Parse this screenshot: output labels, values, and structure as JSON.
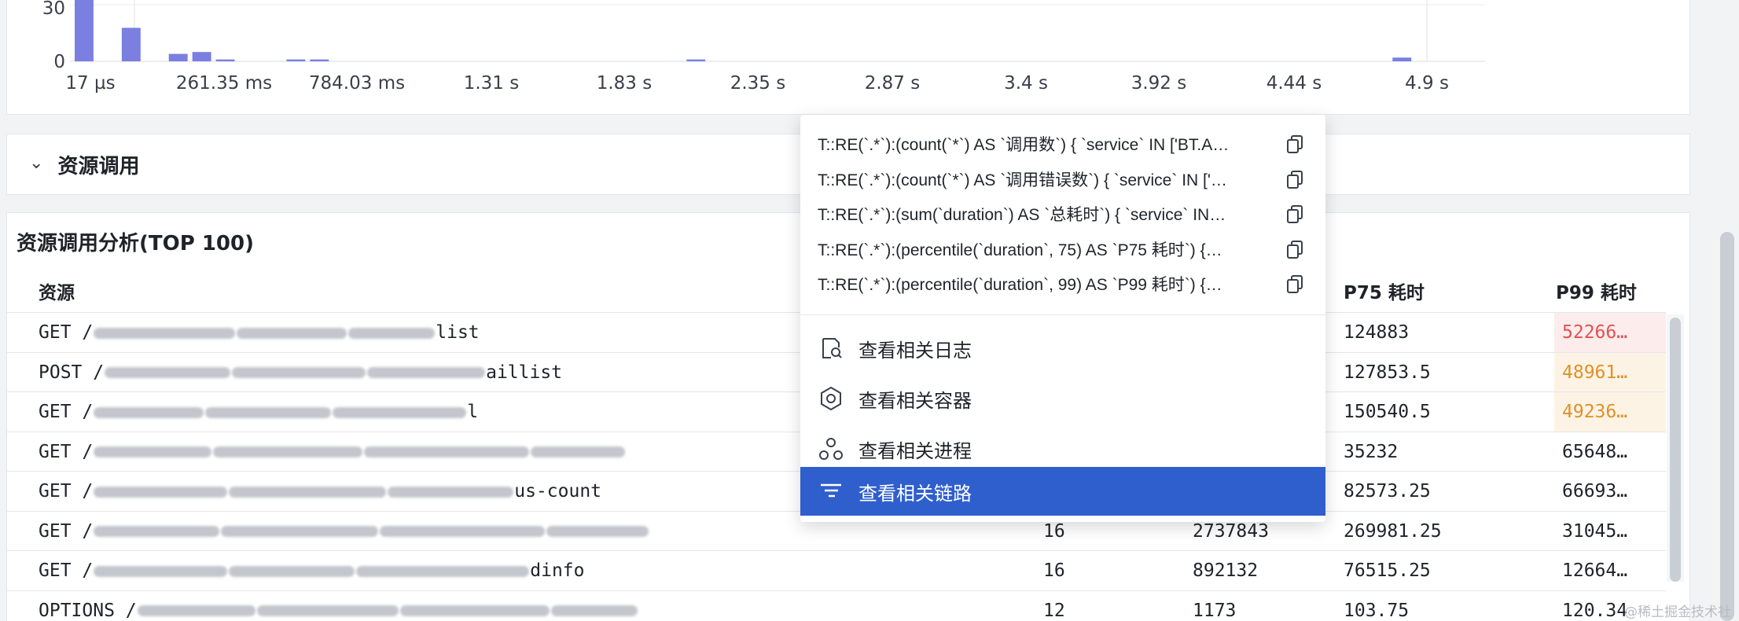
{
  "histogram": {
    "y_ticks": [
      "30",
      "0"
    ],
    "x_ticks": [
      "17 µs",
      "261.35 ms",
      "784.03 ms",
      "1.31 s",
      "1.83 s",
      "2.35 s",
      "2.87 s",
      "3.4 s",
      "3.92 s",
      "4.44 s",
      "4.9 s"
    ],
    "bar_color": "#7b7fe0",
    "bars": [
      {
        "bin": 0,
        "count": 38
      },
      {
        "bin": 2,
        "count": 18
      },
      {
        "bin": 4,
        "count": 4
      },
      {
        "bin": 5,
        "count": 5
      },
      {
        "bin": 6,
        "count": 1
      },
      {
        "bin": 9,
        "count": 1
      },
      {
        "bin": 10,
        "count": 1
      },
      {
        "bin": 26,
        "count": 1
      },
      {
        "bin": 56,
        "count": 2
      }
    ]
  },
  "collapse": {
    "chevron": "chevron-down-icon",
    "label": "资源调用"
  },
  "table": {
    "title": "资源调用分析(TOP 100)",
    "headers": {
      "resource": "资源",
      "p75": "P75 耗时",
      "p99": "P99 耗时"
    },
    "rows": [
      {
        "method": "GET",
        "path_visible": "list",
        "a": "",
        "b": "",
        "p75": "124883",
        "p99": "52266…",
        "p99_level": "red"
      },
      {
        "method": "POST",
        "path_visible": "aillist",
        "a": "",
        "b": "",
        "p75": "127853.5",
        "p99": "48961…",
        "p99_level": "orange"
      },
      {
        "method": "GET",
        "path_visible": "l",
        "a": "",
        "b": "",
        "p75": "150540.5",
        "p99": "49236…",
        "p99_level": "orange"
      },
      {
        "method": "GET",
        "path_visible": "",
        "a": "",
        "b": "",
        "p75": "35232",
        "p99": "65648…",
        "p99_level": "normal"
      },
      {
        "method": "GET",
        "path_visible": "us-count",
        "a": "",
        "b": "",
        "p75": "82573.25",
        "p99": "66693…",
        "p99_level": "normal"
      },
      {
        "method": "GET",
        "path_visible": "",
        "a": "16",
        "b": "2737843",
        "p75": "269981.25",
        "p99": "31045…",
        "p99_level": "normal"
      },
      {
        "method": "GET",
        "path_visible": "dinfo",
        "a": "16",
        "b": "892132",
        "p75": "76515.25",
        "p99": "12664…",
        "p99_level": "normal"
      },
      {
        "method": "OPTIONS",
        "path_visible": "",
        "a": "12",
        "b": "1173",
        "p75": "103.75",
        "p99": "120.34",
        "p99_level": "normal"
      }
    ],
    "colors": {
      "red_bg": "#fdecec",
      "red_text": "#e05252",
      "orange_bg": "#fdf3e4",
      "orange_text": "#e0902a"
    }
  },
  "menu": {
    "queries": [
      {
        "text": "T::RE(`.*`):(count(`*`) AS `调用数`) { `service` IN ['BT.A…",
        "icon": "copy-icon"
      },
      {
        "text": "T::RE(`.*`):(count(`*`) AS `调用错误数`) { `service` IN ['…",
        "icon": "copy-icon"
      },
      {
        "text": "T::RE(`.*`):(sum(`duration`) AS `总耗时`) { `service` IN…",
        "icon": "copy-icon"
      },
      {
        "text": "T::RE(`.*`):(percentile(`duration`, 75) AS `P75 耗时`) {…",
        "icon": "copy-icon"
      },
      {
        "text": "T::RE(`.*`):(percentile(`duration`, 99) AS `P99 耗时`) {…",
        "icon": "copy-icon"
      }
    ],
    "actions": [
      {
        "label": "查看相关日志",
        "icon": "log-search-icon"
      },
      {
        "label": "查看相关容器",
        "icon": "container-hexagon-icon"
      },
      {
        "label": "查看相关进程",
        "icon": "process-icon"
      },
      {
        "label": "查看相关链路",
        "icon": "trace-icon",
        "active": true
      }
    ],
    "active_color": "#2f5fcc"
  },
  "watermark": "@稀土掘金技术社区"
}
